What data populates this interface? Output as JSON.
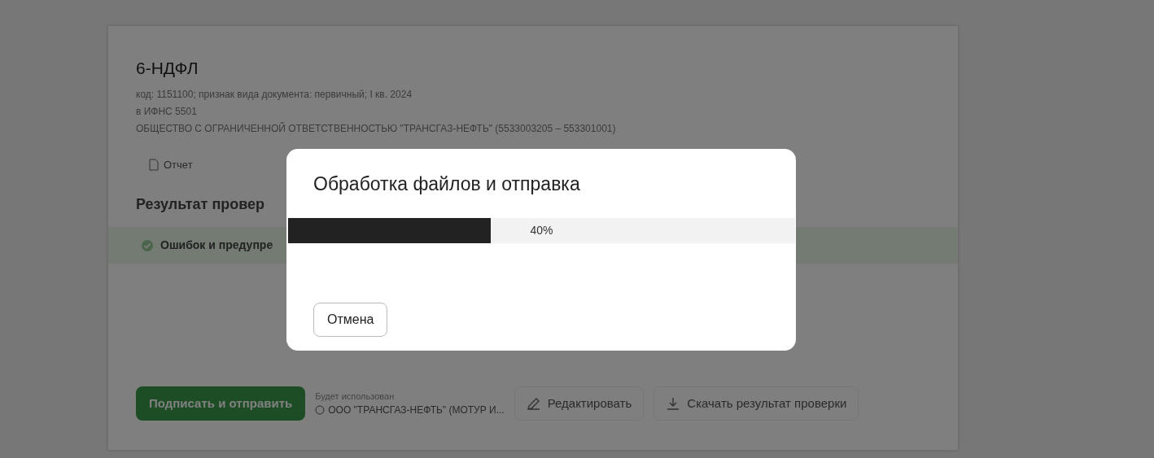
{
  "document": {
    "title": "6-НДФЛ",
    "details": [
      "код: 1151100; признак вида документа: первичный; I кв. 2024",
      "в ИФНС 5501",
      "ОБЩЕСТВО С ОГРАНИЧЕННОЙ ОТВЕТСТВЕННОСТЬЮ \"ТРАНСГАЗ-НЕФТЬ\" (5533003205 – 553301001)"
    ],
    "attachment": "Отчет",
    "check_title": "Результат провер",
    "check_result": "Ошибок и предупре"
  },
  "footer": {
    "sign_button": "Подписать и отправить",
    "signature_caption": "Будет использован",
    "signature_owner": "ООО \"ТРАНСГАЗ-НЕФТЬ\" (МОТУР И...",
    "edit_button": "Редактировать",
    "download_button": "Скачать результат проверки"
  },
  "dialog": {
    "title": "Обработка файлов и отправка",
    "progress": {
      "level": 0.4,
      "reading": "40%"
    },
    "cancel_button": "Отмена"
  }
}
